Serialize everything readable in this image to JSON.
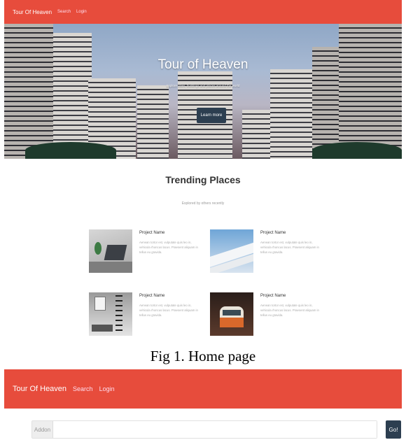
{
  "home": {
    "brand": "Tour Of Heaven",
    "nav": [
      "Search",
      "Login"
    ],
    "hero": {
      "title": "Tour of Heaven",
      "subtitle": "Explore cities, buildings and places around the world",
      "button": "Learn more"
    },
    "trending": {
      "title": "Trending Places",
      "subtitle": "Explored by others recently",
      "cards": [
        {
          "name": "Project Name",
          "desc": "Aenean tortor est, vulputate quis leo in, vehicula rhoncus lacus. Praesent aliquam in tellus eu gravida.",
          "image": "laptop-desk-photo"
        },
        {
          "name": "Project Name",
          "desc": "Aenean tortor est, vulputate quis leo in, vehicula rhoncus lacus. Praesent aliquam in tellus eu gravida.",
          "image": "building-facade-photo"
        },
        {
          "name": "Project Name",
          "desc": "Aenean tortor est, vulputate quis leo in, vehicula rhoncus lacus. Praesent aliquam in tellus eu gravida.",
          "image": "loft-interior-photo"
        },
        {
          "name": "Project Name",
          "desc": "Aenean tortor est, vulputate quis leo in, vehicula rhoncus lacus. Praesent aliquam in tellus eu gravida.",
          "image": "vw-van-photo"
        }
      ]
    }
  },
  "caption1": "Fig 1. Home page",
  "search_page": {
    "brand": "Tour Of Heaven",
    "nav": [
      "Search",
      "Login"
    ],
    "addon": "Addon",
    "placeholder": "",
    "button": "Go!"
  },
  "colors": {
    "nav": "#e74c3c",
    "button": "#2c3e50"
  }
}
